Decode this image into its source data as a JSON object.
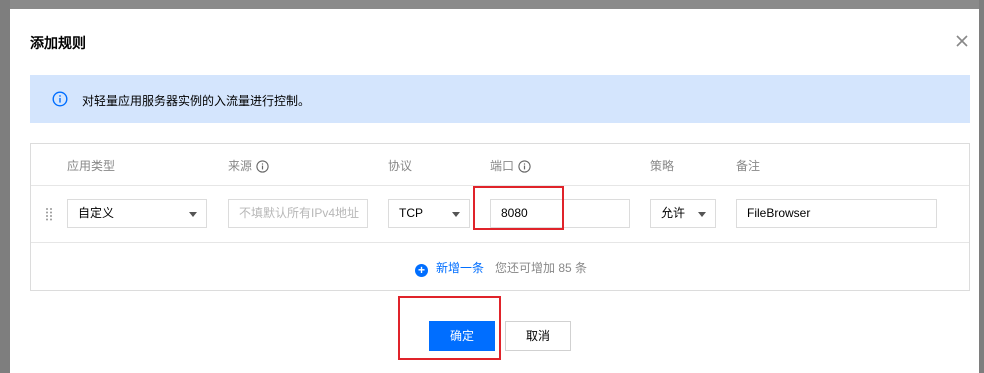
{
  "dialog": {
    "title": "添加规则",
    "close_icon": "close-icon"
  },
  "notice": {
    "icon": "info-icon",
    "text": "对轻量应用服务器实例的入流量进行控制。"
  },
  "table": {
    "headers": {
      "type": "应用类型",
      "source": "来源",
      "protocol": "协议",
      "port": "端口",
      "policy": "策略",
      "remark": "备注"
    },
    "row": {
      "type_value": "自定义",
      "source_placeholder": "不填默认所有IPv4地址",
      "protocol_value": "TCP",
      "port_value": "8080",
      "policy_value": "允许",
      "remark_value": "FileBrowser"
    },
    "add_label": "新增一条",
    "add_hint": "您还可增加 85 条"
  },
  "footer": {
    "confirm_label": "确定",
    "cancel_label": "取消"
  },
  "colors": {
    "accent": "#006eff",
    "notice_bg": "#d4e5fd",
    "highlight": "#e0232a"
  }
}
